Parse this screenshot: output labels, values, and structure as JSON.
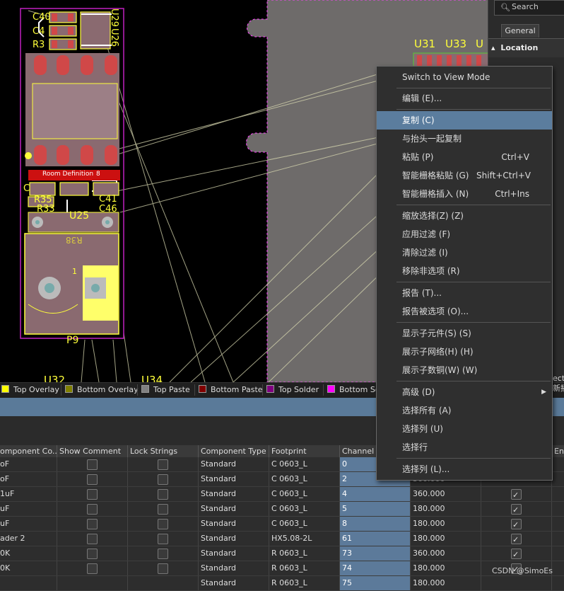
{
  "canvas": {
    "designators": {
      "c40": "C40",
      "c42": "C4",
      "r3": "R3",
      "u29": "U29",
      "u26": "U26",
      "room_def": "Room Definition",
      "room_num": "8",
      "c4x": "C",
      "r35": "R35",
      "r33": "R33",
      "u25": "U25",
      "c41": "C41",
      "c46": "C46",
      "r38": "R38",
      "pin1": "1",
      "p9": "P9",
      "u31": "U31",
      "u33": "U33",
      "u3x": "U",
      "u32": "U32",
      "u34": "U34"
    }
  },
  "properties_panel": {
    "search_placeholder": "Search",
    "tab": "General",
    "section": "Location"
  },
  "layer_tabs": [
    {
      "label": "Top Overlay",
      "color": "#ffff00"
    },
    {
      "label": "Bottom Overlay",
      "color": "#808000"
    },
    {
      "label": "Top Paste",
      "color": "#808080"
    },
    {
      "label": "Bottom Paste",
      "color": "#800000"
    },
    {
      "label": "Top Solder",
      "color": "#800080"
    },
    {
      "label": "Bottom So",
      "color": "#ff00ff"
    }
  ],
  "right_edge": {
    "line1": "ecto",
    "line2": "新播"
  },
  "grid": {
    "columns": [
      {
        "label": "omponent Co..."
      },
      {
        "label": "Show Comment"
      },
      {
        "label": "Lock Strings"
      },
      {
        "label": "Component Type"
      },
      {
        "label": "Footprint"
      },
      {
        "label": "Channel O"
      },
      {
        "label": ""
      },
      {
        "label": ""
      },
      {
        "label": "En"
      }
    ],
    "rows": [
      {
        "comment": "oF",
        "type": "Standard",
        "footprint": "C 0603_L",
        "channel": "0",
        "rotation": "",
        "checked": false
      },
      {
        "comment": "oF",
        "type": "Standard",
        "footprint": "C 0603_L",
        "channel": "2",
        "rotation": "360.000",
        "checked": false
      },
      {
        "comment": "1uF",
        "type": "Standard",
        "footprint": "C 0603_L",
        "channel": "4",
        "rotation": "360.000",
        "checked": true
      },
      {
        "comment": "uF",
        "type": "Standard",
        "footprint": "C 0603_L",
        "channel": "5",
        "rotation": "180.000",
        "checked": true
      },
      {
        "comment": "uF",
        "type": "Standard",
        "footprint": "C 0603_L",
        "channel": "8",
        "rotation": "180.000",
        "checked": true
      },
      {
        "comment": "ader 2",
        "type": "Standard",
        "footprint": "HX5.08-2L",
        "channel": "61",
        "rotation": "180.000",
        "checked": true
      },
      {
        "comment": "0K",
        "type": "Standard",
        "footprint": "R 0603_L",
        "channel": "73",
        "rotation": "360.000",
        "checked": true
      },
      {
        "comment": "0K",
        "type": "Standard",
        "footprint": "R 0603_L",
        "channel": "74",
        "rotation": "180.000",
        "checked": true
      },
      {
        "comment": "",
        "type": "Standard",
        "footprint": "R 0603_L",
        "channel": "75",
        "rotation": "180.000",
        "checked": false
      }
    ]
  },
  "watermark": "CSDN @SimoEs",
  "context_menu": {
    "items": [
      {
        "label": "Switch to View Mode",
        "shortcut": ""
      },
      {
        "label": "编辑 (E)...",
        "shortcut": ""
      },
      {
        "label": "复制 (C)",
        "shortcut": "",
        "highlighted": true
      },
      {
        "label": "与抬头一起复制",
        "shortcut": ""
      },
      {
        "label": "粘贴 (P)",
        "shortcut": "Ctrl+V"
      },
      {
        "label": "智能栅格粘贴 (G)",
        "shortcut": "Shift+Ctrl+V"
      },
      {
        "label": "智能栅格插入 (N)",
        "shortcut": "Ctrl+Ins"
      },
      {
        "label": "缩放选择(Z) (Z)",
        "shortcut": ""
      },
      {
        "label": "应用过滤 (F)",
        "shortcut": ""
      },
      {
        "label": "清除过滤 (I)",
        "shortcut": ""
      },
      {
        "label": "移除非选项 (R)",
        "shortcut": ""
      },
      {
        "label": "报告 (T)...",
        "shortcut": ""
      },
      {
        "label": "报告被选项 (O)...",
        "shortcut": ""
      },
      {
        "label": "显示子元件(S) (S)",
        "shortcut": ""
      },
      {
        "label": "展示子网络(H) (H)",
        "shortcut": ""
      },
      {
        "label": "展示子数铜(W) (W)",
        "shortcut": ""
      },
      {
        "label": "高级 (D)",
        "shortcut": "",
        "submenu": true
      },
      {
        "label": "选择所有 (A)",
        "shortcut": ""
      },
      {
        "label": "选择列 (U)",
        "shortcut": ""
      },
      {
        "label": "选择行",
        "shortcut": ""
      },
      {
        "label": "选择列 (L)...",
        "shortcut": ""
      }
    ]
  }
}
